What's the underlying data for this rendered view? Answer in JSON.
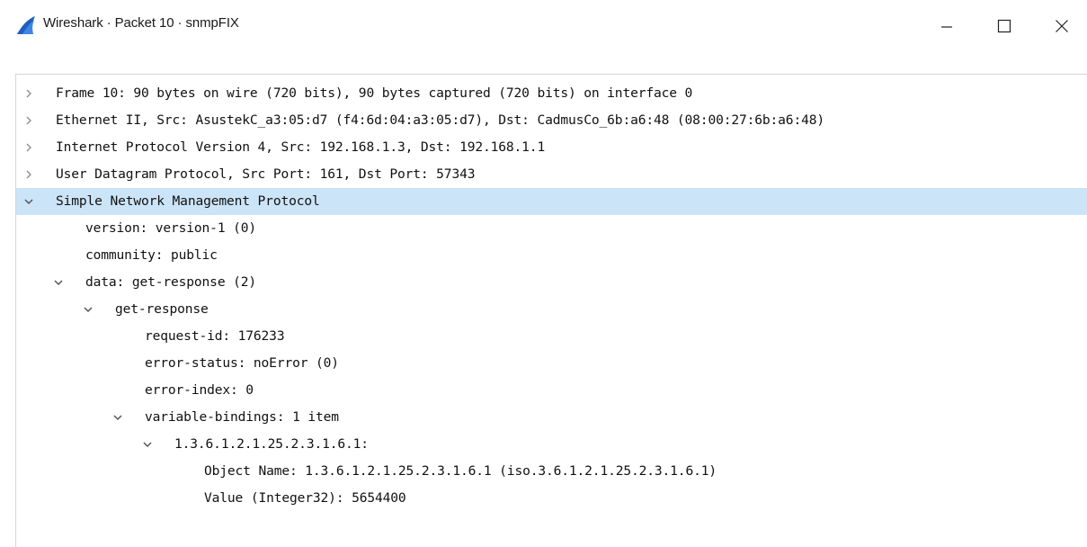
{
  "window": {
    "title": "Wireshark · Packet 10 · snmpFIX",
    "app_icon": "wireshark-fin-icon",
    "controls": [
      "minimize-icon",
      "maximize-icon",
      "close-icon"
    ]
  },
  "colors": {
    "selection": "#cce4f7",
    "icon_blue": "#1f5fbf",
    "text": "#111111",
    "toggle": "#8a8a8a"
  },
  "tree": [
    {
      "text": "Frame 10: 90 bytes on wire (720 bits), 90 bytes captured (720 bits) on interface 0",
      "depth": 0,
      "toggle": "collapsed",
      "selected": false
    },
    {
      "text": "Ethernet II, Src: AsustekC_a3:05:d7 (f4:6d:04:a3:05:d7), Dst: CadmusCo_6b:a6:48 (08:00:27:6b:a6:48)",
      "depth": 0,
      "toggle": "collapsed",
      "selected": false
    },
    {
      "text": "Internet Protocol Version 4, Src: 192.168.1.3, Dst: 192.168.1.1",
      "depth": 0,
      "toggle": "collapsed",
      "selected": false
    },
    {
      "text": "User Datagram Protocol, Src Port: 161, Dst Port: 57343",
      "depth": 0,
      "toggle": "collapsed",
      "selected": false
    },
    {
      "text": "Simple Network Management Protocol",
      "depth": 0,
      "toggle": "expanded",
      "selected": true
    },
    {
      "text": "version: version-1 (0)",
      "depth": 1,
      "toggle": "none",
      "selected": false
    },
    {
      "text": "community: public",
      "depth": 1,
      "toggle": "none",
      "selected": false
    },
    {
      "text": "data: get-response (2)",
      "depth": 1,
      "toggle": "expanded",
      "selected": false
    },
    {
      "text": "get-response",
      "depth": 2,
      "toggle": "expanded",
      "selected": false
    },
    {
      "text": "request-id: 176233",
      "depth": 3,
      "toggle": "none",
      "selected": false
    },
    {
      "text": "error-status: noError (0)",
      "depth": 3,
      "toggle": "none",
      "selected": false
    },
    {
      "text": "error-index: 0",
      "depth": 3,
      "toggle": "none",
      "selected": false
    },
    {
      "text": "variable-bindings: 1 item",
      "depth": 3,
      "toggle": "expanded",
      "selected": false
    },
    {
      "text": "1.3.6.1.2.1.25.2.3.1.6.1:",
      "depth": 4,
      "toggle": "expanded",
      "selected": false
    },
    {
      "text": "Object Name: 1.3.6.1.2.1.25.2.3.1.6.1 (iso.3.6.1.2.1.25.2.3.1.6.1)",
      "depth": 5,
      "toggle": "none",
      "selected": false
    },
    {
      "text": "Value (Integer32): 5654400",
      "depth": 5,
      "toggle": "none",
      "selected": false
    }
  ]
}
